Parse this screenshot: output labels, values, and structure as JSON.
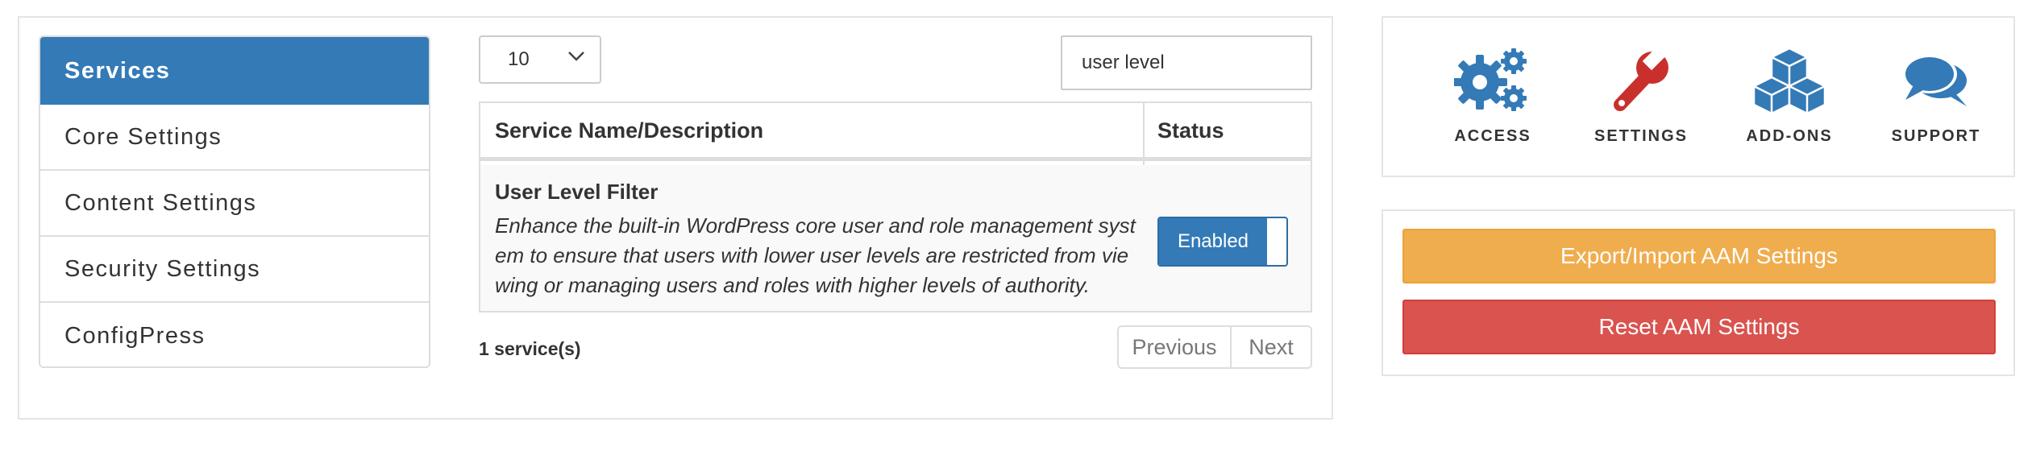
{
  "sidebar": {
    "items": [
      {
        "label": "Services",
        "active": true
      },
      {
        "label": "Core Settings"
      },
      {
        "label": "Content Settings"
      },
      {
        "label": "Security Settings"
      },
      {
        "label": "ConfigPress"
      }
    ]
  },
  "table_controls": {
    "page_size": "10",
    "search_value": "user level"
  },
  "table": {
    "columns": [
      "Service Name/Description",
      "Status"
    ],
    "rows": [
      {
        "title": "User Level Filter",
        "description": "Enhance the built-in WordPress core user and role management system to ensure that users with lower user levels are restricted from viewing or managing users and roles with higher levels of authority.",
        "status": "Enabled"
      }
    ]
  },
  "footer": {
    "count": "1 service(s)",
    "previous": "Previous",
    "next": "Next"
  },
  "quick_links": [
    {
      "label": "ACCESS",
      "icon": "gears-icon"
    },
    {
      "label": "SETTINGS",
      "icon": "wrench-icon"
    },
    {
      "label": "ADD-ONS",
      "icon": "cubes-icon"
    },
    {
      "label": "SUPPORT",
      "icon": "comments-icon"
    }
  ],
  "actions": {
    "export_label": "Export/Import AAM Settings",
    "reset_label": "Reset AAM Settings"
  },
  "colors": {
    "primary": "#337ab7",
    "warning": "#f0ad4e",
    "danger": "#d9534f",
    "settings_icon": "#c9302c"
  }
}
